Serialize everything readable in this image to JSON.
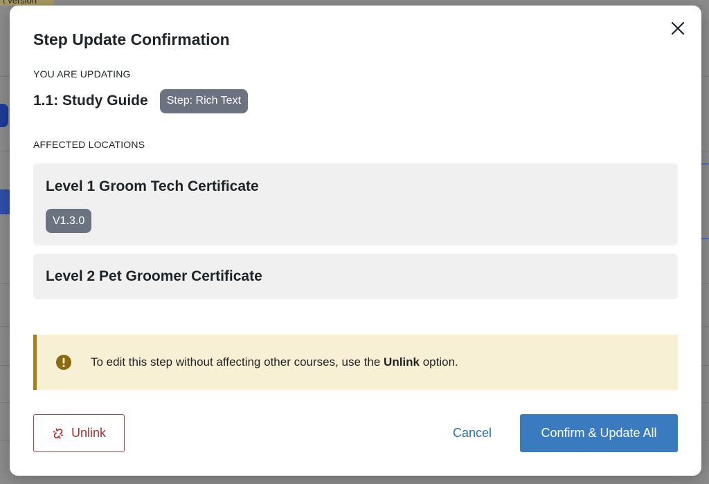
{
  "background": {
    "top_badge_text": "t version"
  },
  "modal": {
    "title": "Step Update Confirmation",
    "updating_label": "YOU ARE UPDATING",
    "step_name": "1.1: Study Guide",
    "step_badge": "Step: Rich Text",
    "affected_label": "AFFECTED LOCATIONS",
    "locations": [
      {
        "name": "Level 1 Groom Tech Certificate",
        "version": "V1.3.0"
      },
      {
        "name": "Level 2 Pet Groomer Certificate"
      }
    ],
    "notice": {
      "text_before": "To edit this step without affecting other courses, use the ",
      "text_bold": "Unlink",
      "text_after": " option."
    },
    "buttons": {
      "unlink": "Unlink",
      "cancel": "Cancel",
      "confirm": "Confirm & Update All"
    }
  },
  "colors": {
    "primary": "#3a7bc0",
    "danger": "#b32d2e",
    "notice_bg": "#f8f0d4",
    "notice_border": "#a58018",
    "badge_bg": "#6b7280"
  },
  "icons": {
    "close": "close-icon",
    "notice": "exclamation-circle-icon",
    "unlink": "unlink-icon"
  }
}
